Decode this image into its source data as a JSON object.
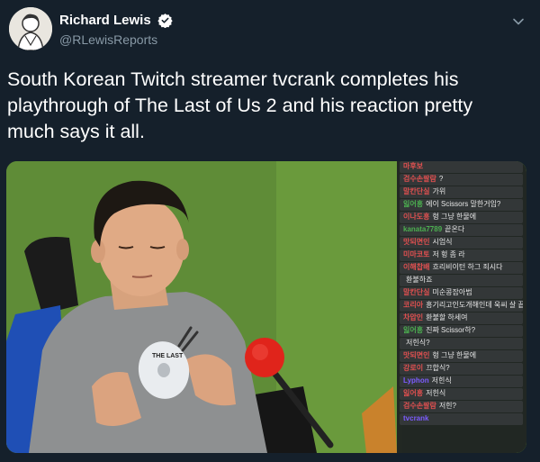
{
  "user": {
    "display_name": "Richard Lewis",
    "handle": "@RLewisReports"
  },
  "tweet": {
    "text": "South Korean Twitch streamer tvcrank completes his\nplaythrough of The Last of Us 2 and his reaction pretty\nmuch says it all."
  },
  "media": {
    "disc_label": "THE LAST",
    "chat": [
      {
        "nick": "마후보",
        "text": "",
        "color": "#e05050"
      },
      {
        "nick": "검수손팔람",
        "text": "?",
        "color": "#e05050"
      },
      {
        "nick": "말칸단실",
        "text": "가위",
        "color": "#e05050"
      },
      {
        "nick": "잃어흥",
        "text": "에이 Scissors 말한거임?",
        "color": "#4caf50"
      },
      {
        "nick": "이나도흥",
        "text": "헝 그냥 한물에",
        "color": "#e05050"
      },
      {
        "nick": "kanata7789",
        "text": "끝온다",
        "color": "#4caf50"
      },
      {
        "nick": "맛되면인",
        "text": "시엄식",
        "color": "#e05050"
      },
      {
        "nick": "미마코토",
        "text": "저 헝 좀 라",
        "color": "#e05050"
      },
      {
        "nick": "이해찹배",
        "text": "흐리비이턴 하그 죄시다",
        "color": "#e05050"
      },
      {
        "nick": "",
        "text": "환불하죠",
        "color": "#7c5cff"
      },
      {
        "nick": "말칸단실",
        "text": "미순콩잡아범",
        "color": "#e05050"
      },
      {
        "nick": "코리아",
        "text": "흥기리고인도개해인데 욱씨 살 끝났편도",
        "color": "#e05050"
      },
      {
        "nick": "차압인",
        "text": "환불할 하세여",
        "color": "#e05050"
      },
      {
        "nick": "잃어흥",
        "text": "진짜 Scissor하?",
        "color": "#4caf50"
      },
      {
        "nick": "",
        "text": "저힌식?",
        "color": "#7c5cff"
      },
      {
        "nick": "맛되면인",
        "text": "헝 그냥 한물에",
        "color": "#e05050"
      },
      {
        "nick": "강로이",
        "text": "끄합식?",
        "color": "#e05050"
      },
      {
        "nick": "Lyphon",
        "text": "저힌식",
        "color": "#7c5cff"
      },
      {
        "nick": "잃어흥",
        "text": "저힌식",
        "color": "#e05050"
      },
      {
        "nick": "검수손팔람",
        "text": "저힌?",
        "color": "#e05050"
      },
      {
        "nick": "tvcrank",
        "text": "",
        "color": "#7c5cff"
      }
    ]
  },
  "colors": {
    "background": "#15202b",
    "secondary_text": "#8899a6",
    "verified": "#ffffff"
  },
  "icons": [
    "verified-badge-icon",
    "chevron-down-icon"
  ]
}
